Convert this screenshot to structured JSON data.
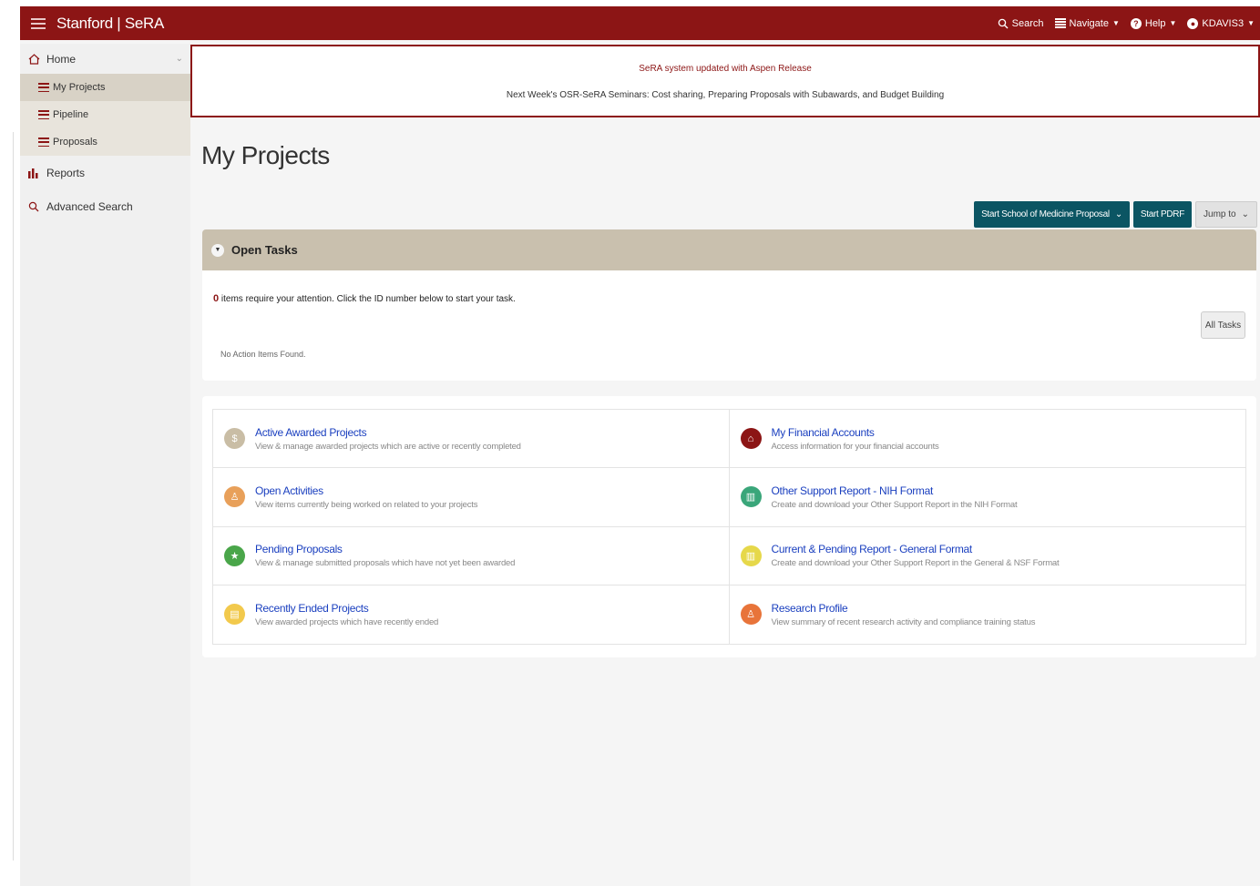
{
  "app": {
    "brand": "Stanford | SeRA"
  },
  "topnav": {
    "search": "Search",
    "navigate": "Navigate",
    "help": "Help",
    "user": "KDAVIS3"
  },
  "sidebar": {
    "home": "Home",
    "items": [
      {
        "label": "My Projects",
        "active": true
      },
      {
        "label": "Pipeline"
      },
      {
        "label": "Proposals"
      }
    ],
    "reports": "Reports",
    "advanced_search": "Advanced Search"
  },
  "banner": {
    "line1": "SeRA system updated with Aspen Release",
    "line2": "Next Week's OSR-SeRA Seminars: Cost sharing, Preparing Proposals with Subawards, and Budget Building"
  },
  "page": {
    "title": "My Projects"
  },
  "actions": {
    "start_som": "Start School of Medicine Proposal",
    "start_pdrf": "Start PDRF",
    "jump_to": "Jump to"
  },
  "tasks": {
    "header": "Open Tasks",
    "count": "0",
    "message": "items require your attention. Click the ID number below to start your task.",
    "empty": "No Action Items Found.",
    "all_tasks": "All Tasks"
  },
  "links": [
    {
      "title": "Active Awarded Projects",
      "desc": "View & manage awarded projects which are active or recently completed",
      "color": "#c9bda5",
      "glyph": "$",
      "icon": "dollar-icon"
    },
    {
      "title": "My Financial Accounts",
      "desc": "Access information for your financial accounts",
      "color": "#8c1515",
      "glyph": "⌂",
      "icon": "bank-icon"
    },
    {
      "title": "Open Activities",
      "desc": "View items currently being worked on related to your projects",
      "color": "#e8a05a",
      "glyph": "♙",
      "icon": "person-icon"
    },
    {
      "title": "Other Support Report - NIH Format",
      "desc": "Create and download your Other Support Report in the NIH Format",
      "color": "#3aa67a",
      "glyph": "▥",
      "icon": "chart-icon"
    },
    {
      "title": "Pending Proposals",
      "desc": "View & manage submitted proposals which have not yet been awarded",
      "color": "#4aa64a",
      "glyph": "★",
      "icon": "star-icon"
    },
    {
      "title": "Current & Pending Report - General Format",
      "desc": "Create and download your Other Support Report in the General & NSF Format",
      "color": "#e6d84a",
      "glyph": "▥",
      "icon": "chart-icon"
    },
    {
      "title": "Recently Ended Projects",
      "desc": "View awarded projects which have recently ended",
      "color": "#f2c94c",
      "glyph": "▤",
      "icon": "document-icon"
    },
    {
      "title": "Research Profile",
      "desc": "View summary of recent research activity and compliance training status",
      "color": "#e8743a",
      "glyph": "♙",
      "icon": "profile-icon"
    }
  ]
}
